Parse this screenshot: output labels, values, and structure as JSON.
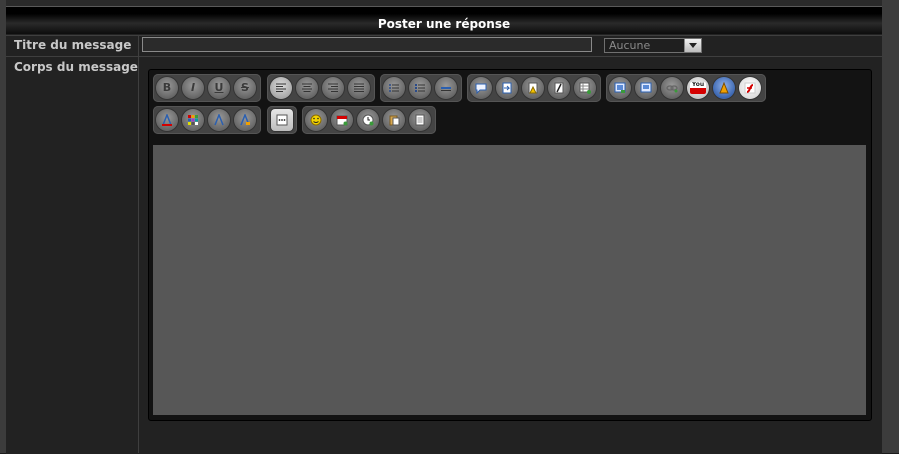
{
  "header": {
    "title": "Poster une réponse"
  },
  "form": {
    "title_label": "Titre du message",
    "title_value": "",
    "select_value": "Aucune",
    "body_label": "Corps du message",
    "body_value": ""
  },
  "toolbar": {
    "groups": [
      {
        "name": "text-style",
        "icons": [
          "bold-icon",
          "italic-icon",
          "underline-icon",
          "strikethrough-icon"
        ]
      },
      {
        "name": "alignment",
        "icons": [
          "align-left-icon",
          "align-center-icon",
          "align-right-icon",
          "align-justify-icon"
        ]
      },
      {
        "name": "lists",
        "icons": [
          "bulleted-list-icon",
          "numbered-list-icon",
          "horizontal-rule-icon"
        ]
      },
      {
        "name": "blocks",
        "icons": [
          "quote-icon",
          "code-icon",
          "spoiler-icon",
          "hide-icon",
          "table-icon"
        ]
      },
      {
        "name": "media",
        "icons": [
          "image-icon",
          "image-upload-icon",
          "link-icon",
          "youtube-icon",
          "dailymotion-icon",
          "flash-icon"
        ]
      },
      {
        "name": "font",
        "icons": [
          "font-color-icon",
          "color-grid-icon",
          "font-size-icon",
          "font-face-icon"
        ]
      },
      {
        "name": "more",
        "icons": [
          "more-options-icon"
        ]
      },
      {
        "name": "insert",
        "icons": [
          "smiley-icon",
          "date-icon",
          "time-icon",
          "paste-icon",
          "document-icon"
        ]
      }
    ],
    "glyphs": {
      "bold-icon": "B",
      "italic-icon": "I",
      "underline-icon": "U",
      "strikethrough-icon": "S",
      "youtube-icon": "You"
    },
    "colors": {
      "header_bg": "#000000",
      "button_bg": "#7a7a7a",
      "editor_area": "#575757"
    }
  }
}
